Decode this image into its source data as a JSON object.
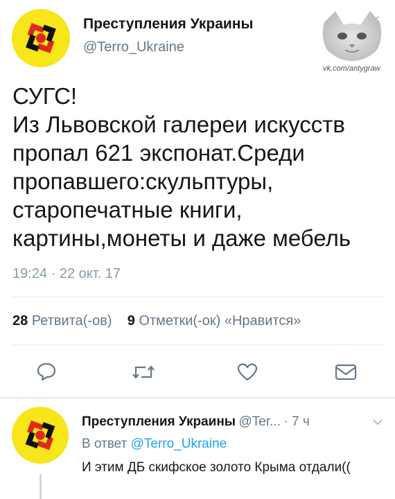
{
  "tweet": {
    "author_name": "Преступления Украины",
    "author_handle": "@Terro_Ukraine",
    "text": "СУГС!\nИз Львовской галереи искусств пропал 621 экспонат.Среди пропавшего:скульптуры, старопечатные книги, картины,монеты и даже мебель",
    "timestamp": "19:24 · 22 окт. 17",
    "retweet_count": "28",
    "retweet_label": "Ретвита(-ов)",
    "like_count": "9",
    "like_label": "Отметки(-ок) «Нравится»"
  },
  "watermark": {
    "text": "vk.com/antygraw",
    "icon": "cat-face-image"
  },
  "actions": [
    {
      "icon": "reply-icon"
    },
    {
      "icon": "retweet-icon"
    },
    {
      "icon": "like-heart-icon"
    },
    {
      "icon": "direct-message-icon"
    }
  ],
  "reply": {
    "author_name": "Преступления Украины",
    "author_handle": "@Ter...",
    "time": "· 7 ч",
    "in_reply_prefix": "В ответ",
    "in_reply_handle": "@Terro_Ukraine",
    "text": "И этим ДБ скифское золото Крыма отдали(("
  },
  "colors": {
    "avatar_bg": "#f6e61a",
    "avatar_symbol": "#e0281c",
    "link": "#1da1f2",
    "secondary_text": "#657786"
  }
}
